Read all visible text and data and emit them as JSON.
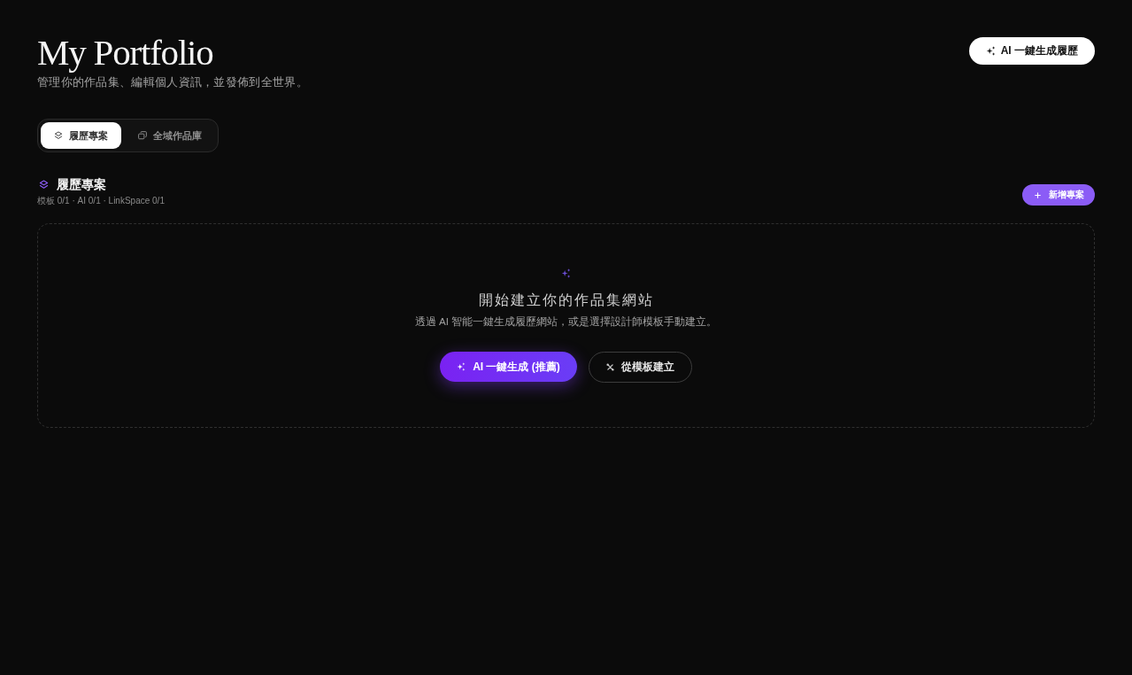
{
  "header": {
    "title": "My Portfolio",
    "subtitle": "管理你的作品集、編輯個人資訊，並發佈到全世界。",
    "action": {
      "label": "AI 一鍵生成履歷"
    }
  },
  "tabs": [
    {
      "label": "履歷專案",
      "selected": true
    },
    {
      "label": "全域作品庫",
      "selected": false
    }
  ],
  "section": {
    "title": "履歷專案",
    "stats": "模板 0/1 · AI 0/1 · LinkSpace 0/1",
    "add_button": {
      "label": "新增專案"
    }
  },
  "empty_state": {
    "heading": "開始建立你的作品集網站",
    "description": "透過 AI 智能一鍵生成履歷網站，或是選擇設計師模板手動建立。",
    "buttons": [
      {
        "label": "AI 一鍵生成 (推薦)",
        "kind": "primary"
      },
      {
        "label": "從模板建立",
        "kind": "secondary"
      }
    ]
  }
}
